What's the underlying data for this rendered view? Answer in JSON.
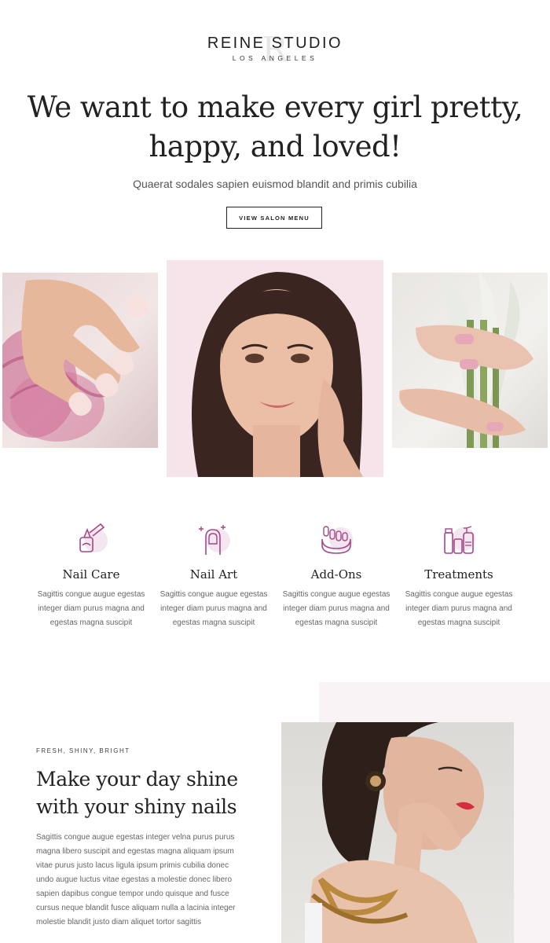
{
  "brand": {
    "name": "REINE STUDIO",
    "city": "LOS ANGELES",
    "mark": "R"
  },
  "hero": {
    "title": "We want to make every girl pretty, happy, and loved!",
    "subtitle": "Quaerat sodales sapien euismod blandit and primis cubilia",
    "cta_label": "VIEW SALON MENU"
  },
  "services": [
    {
      "title": "Nail Care",
      "icon": "nail-polish-icon",
      "text": "Sagittis congue augue egestas integer diam purus magna and egestas magna suscipit"
    },
    {
      "title": "Nail Art",
      "icon": "nail-sparkle-icon",
      "text": "Sagittis congue augue egestas integer diam purus magna and egestas magna suscipit"
    },
    {
      "title": "Add-Ons",
      "icon": "toe-separator-icon",
      "text": "Sagittis congue augue egestas integer diam purus magna and egestas magna suscipit"
    },
    {
      "title": "Treatments",
      "icon": "cosmetics-bottles-icon",
      "text": "Sagittis congue augue egestas integer diam purus magna and egestas magna suscipit"
    }
  ],
  "feature": {
    "eyebrow": "FRESH, SHINY, BRIGHT",
    "title": "Make your day shine with your shiny nails",
    "body": "Sagittis congue augue egestas integer velna purus purus magna libero suscipit and egestas magna aliquam ipsum vitae purus justo lacus ligula ipsum primis cubilia donec undo augue luctus vitae egestas a molestie donec libero sapien dapibus congue tempor undo quisque and fusce cursus neque blandit fusce aliquam nulla a lacinia integer molestie blandit justo diam aliquet tortor sagittis"
  },
  "colors": {
    "accent": "#a8458a",
    "accent_soft": "#f4e6ef",
    "text_dark": "#222222",
    "text_muted": "#666666"
  }
}
